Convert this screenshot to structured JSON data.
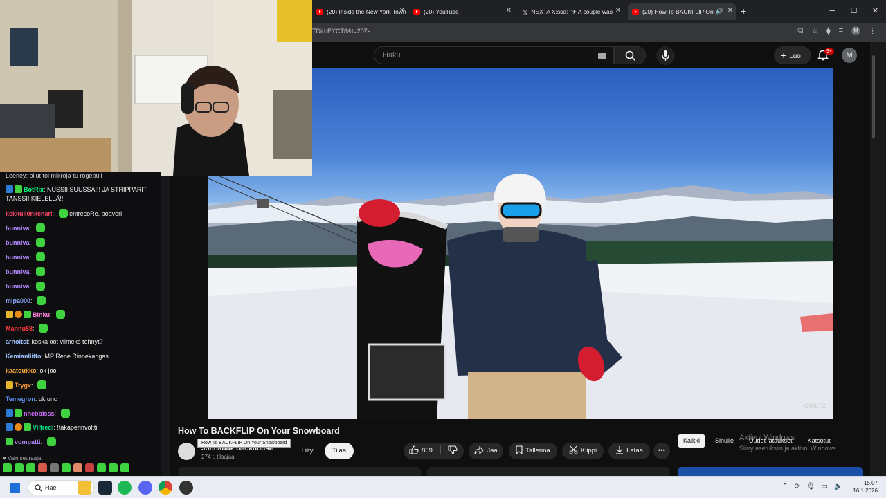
{
  "browser": {
    "tabs": [
      {
        "label": "(20) Inside the New York Town",
        "favicon": "youtube-icon"
      },
      {
        "label": "(20) YouTube",
        "favicon": "youtube-icon"
      },
      {
        "label": "NEXTA X:ssä: \"✈ A couple was",
        "favicon": "x-icon"
      },
      {
        "label": "(20) How To BACKFLIP On Y",
        "favicon": "youtube-icon",
        "active": true
      }
    ],
    "url_fragment": "TDirbEYCT8&t=207s",
    "profile_initial": "M"
  },
  "youtube": {
    "search_placeholder": "Haku",
    "create_label": "Luo",
    "notifications_badge": "9+",
    "avatar_initial": "M",
    "video": {
      "title": "How To BACKFLIP On Your Snowboard",
      "tooltip": "How To BACKFLIP On Your Snowboard",
      "channel_name": "Jonnaduk Backhouse",
      "subscribers": "274 t. tilaajaa",
      "join_label": "Liity",
      "subscribe_label": "Tilaa",
      "like_count": "859",
      "share_label": "Jaa",
      "save_label": "Tallenna",
      "clip_label": "Klippi",
      "download_label": "Lataa",
      "watermark": "GRILTZ"
    },
    "chips": [
      "Kaikki",
      "Sinulle",
      "Uudet lataukset",
      "Katsotut"
    ]
  },
  "windows_activation": {
    "line1": "Aktivoi Windows",
    "line2": "Siirry asetuksiin ja aktivoi Windows."
  },
  "chat": {
    "top_partial": "Leeney: ollut toi mikroja-tu rogebull",
    "messages": [
      {
        "user": "BotRix",
        "color": "#00ff7f",
        "text": "NUSSII SUUSSA!!! JA STRIPPARIT",
        "cont": "TANSSII KIELELLÄ!!!"
      },
      {
        "user": "kekkuli0nkehari",
        "color": "#ff4a6a",
        "text": "entrecoRe, boaveri",
        "emote": true
      },
      {
        "user": "bunniva",
        "color": "#b388ff",
        "emote": true
      },
      {
        "user": "bunniva",
        "color": "#b388ff",
        "emote": true
      },
      {
        "user": "bunniva",
        "color": "#b388ff",
        "emote": true
      },
      {
        "user": "bunniva",
        "color": "#b388ff",
        "emote": true
      },
      {
        "user": "bunniva",
        "color": "#b388ff",
        "emote": true
      },
      {
        "user": "mipa000",
        "color": "#8aa8ff",
        "emote": true
      },
      {
        "user": "Binku",
        "color": "#ff7fdc",
        "emote": true
      },
      {
        "user": "Mannu88",
        "color": "#ff3b3b",
        "emote": true
      },
      {
        "user": "arnoltsi",
        "color": "#9ec3ff",
        "text": "koska oot viimeks tehnyt?"
      },
      {
        "user": "Kemianliitto",
        "color": "#9ec3ff",
        "text": "MP Rene Rinnekangas"
      },
      {
        "user": "kaatoukko",
        "color": "#ffb03b",
        "text": "ok joo"
      },
      {
        "user": "Trygx",
        "color": "#ff9f3b",
        "emote": true
      },
      {
        "user": "Temegron",
        "color": "#5f9bff",
        "text": "ok unc"
      },
      {
        "user": "nnebbisss",
        "color": "#d070ff",
        "emote": true
      },
      {
        "user": "Vilfredi",
        "color": "#00e28a",
        "text": "!takaperinvoltti"
      },
      {
        "user": "vompatti",
        "color": "#b388ff",
        "emote": true
      }
    ],
    "follow_only": "Vain seuraajat"
  },
  "taskbar": {
    "search_label": "Hae",
    "time": "15.07",
    "date": "16.1.2026"
  }
}
